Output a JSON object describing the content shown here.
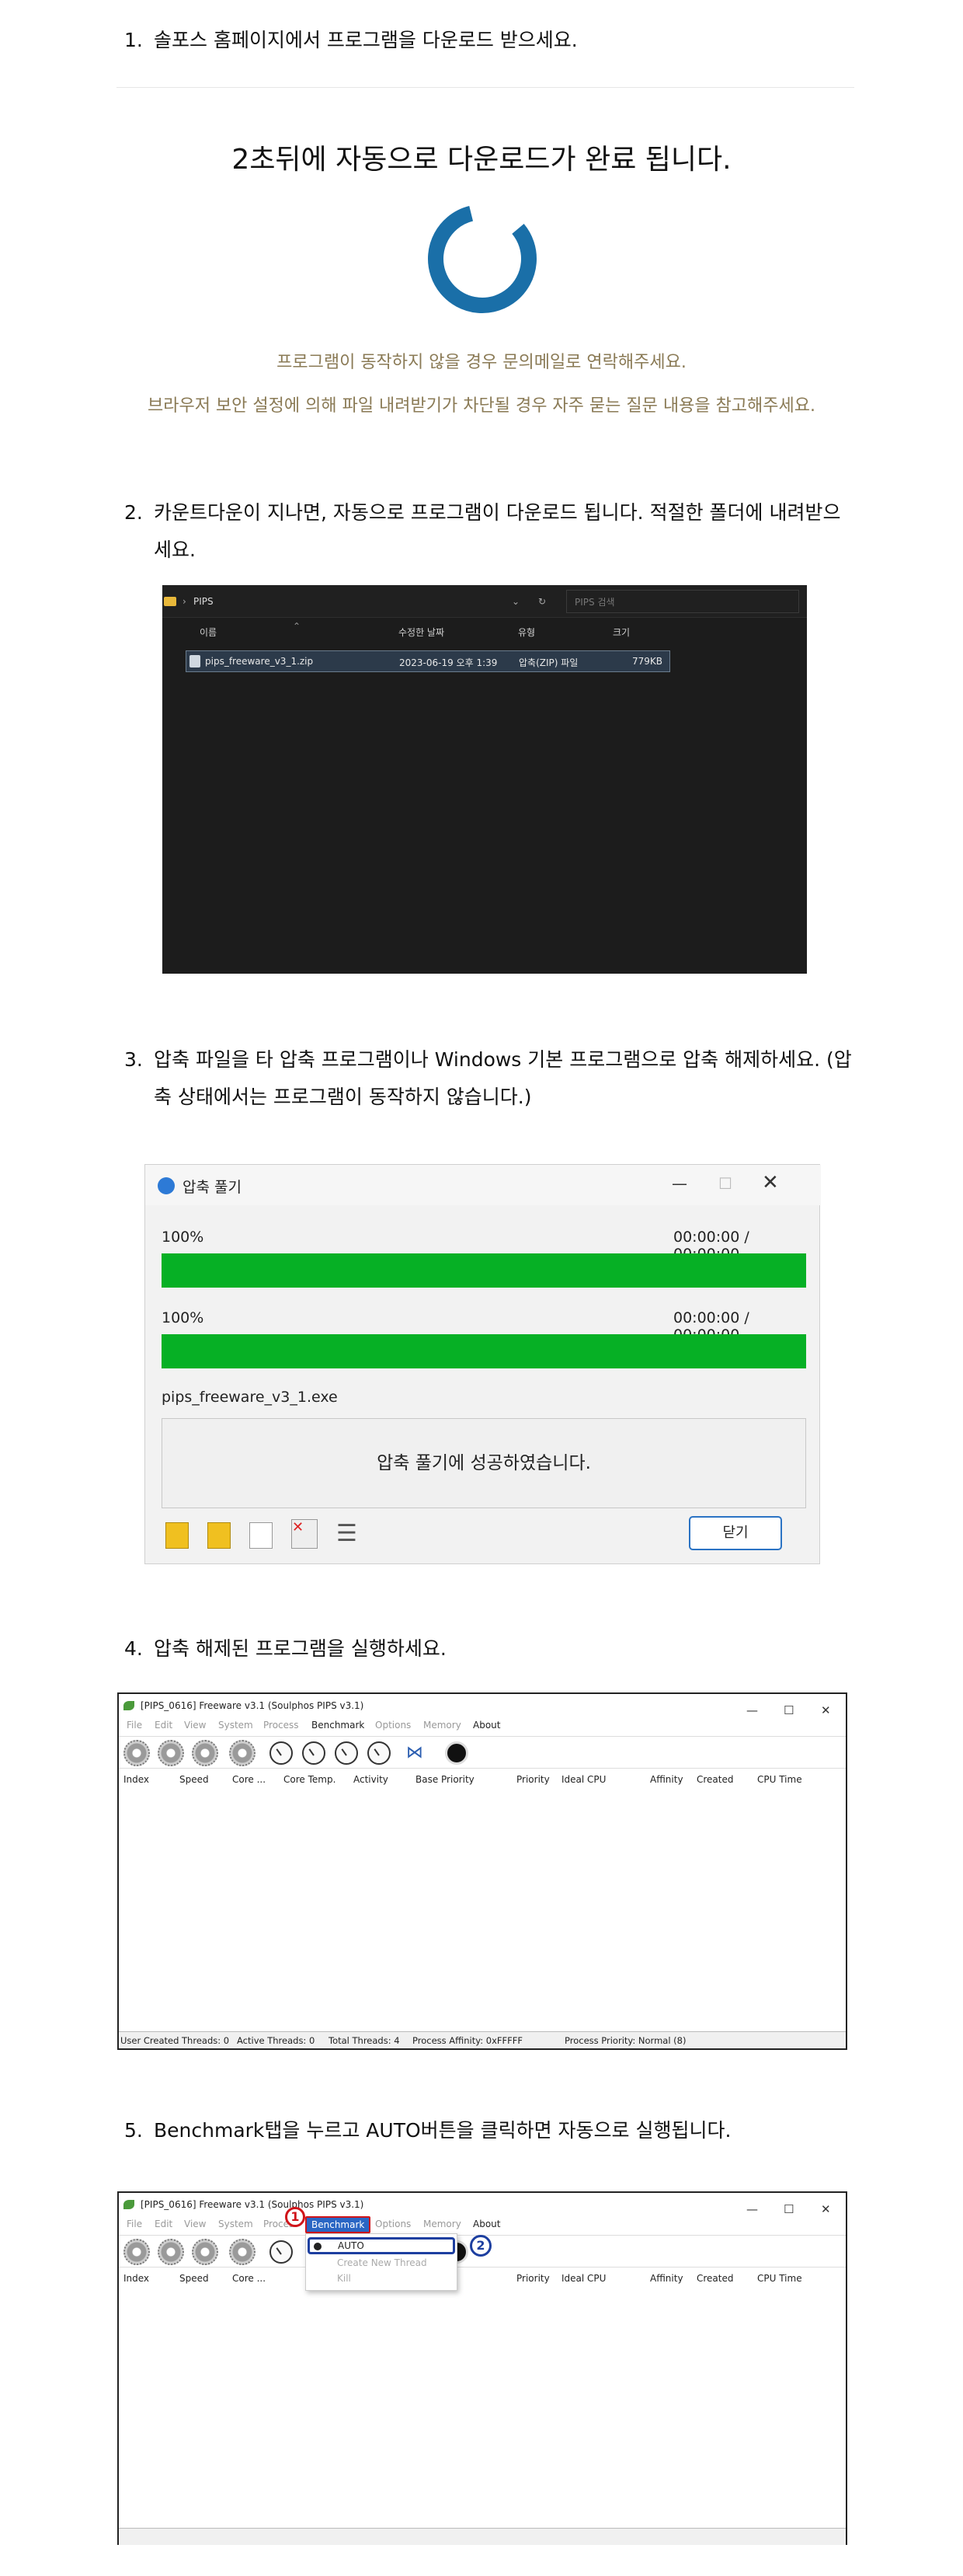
{
  "steps": {
    "s1": {
      "num": "1.",
      "text": "솔포스 홈페이지에서 프로그램을 다운로드 받으세요."
    },
    "s2": {
      "num": "2.",
      "text": "카운트다운이 지나면, 자동으로 프로그램이 다운로드 됩니다. 적절한 폴더에 내려받으세요."
    },
    "s3": {
      "num": "3.",
      "text": "압축 파일을 타 압축 프로그램이나 Windows 기본 프로그램으로 압축 해제하세요. (압축 상태에서는 프로그램이 동작하지 않습니다.)"
    },
    "s4": {
      "num": "4.",
      "text": "압축 해제된 프로그램을 실행하세요."
    },
    "s5": {
      "num": "5.",
      "text": "Benchmark탭을 누르고 AUTO버튼을 클릭하면 자동으로 실행됩니다."
    }
  },
  "download": {
    "countdown_prefix": "2",
    "countdown_text": "초뒤에 자동으로 다운로드가 완료 됩니다.",
    "help1": "프로그램이 동작하지 않을 경우 문의메일로 연락해주세요.",
    "help2": "브라우저 보안 설정에 의해 파일 내려받기가 차단될 경우 자주 묻는 질문 내용을 참고해주세요.",
    "spinner_color": "#1a6fa8"
  },
  "explorer": {
    "path": "PIPS",
    "search_placeholder": "PIPS 검색",
    "columns": [
      "이름",
      "수정한 날짜",
      "유형",
      "크기"
    ],
    "file": {
      "name": "pips_freeware_v3_1.zip",
      "date": "2023-06-19 오후 1:39",
      "type": "압축(ZIP) 파일",
      "size": "779KB"
    }
  },
  "unzip": {
    "title": "압축 풀기",
    "p1_percent": "100%",
    "p1_time": "00:00:00 / 00:00:00",
    "p2_percent": "100%",
    "p2_time": "00:00:00 / 00:00:00",
    "progress_1": 1.0,
    "progress_2": 1.0,
    "filename": "pips_freeware_v3_1.exe",
    "message": "압축 풀기에 성공하였습니다.",
    "close_label": "닫기",
    "bar_color": "#06b025"
  },
  "pips": {
    "title": "[PIPS_0616] Freeware v3.1 (Soulphos PIPS v3.1)",
    "menu": [
      "File",
      "Edit",
      "View",
      "System",
      "Process",
      "Benchmark",
      "Options",
      "Memory",
      "About"
    ],
    "columns": [
      "Index",
      "Speed",
      "Core ...",
      "Core Temp.",
      "Activity",
      "Base Priority",
      "Priority",
      "Ideal CPU",
      "Affinity",
      "Created",
      "CPU Time"
    ],
    "status": [
      "User Created Threads: 0",
      "Active Threads: 0",
      "Total Threads: 4",
      "Process Affinity: 0xFFFFF",
      "Process Priority: Normal (8)"
    ]
  },
  "pips2": {
    "title_short": "[PIPS_0616] Freeware v3.1 (Soulphos PIPS v3.1)",
    "dropdown": [
      "AUTO",
      "Create New Thread",
      "Kill"
    ],
    "marker1": "1",
    "marker2": "2",
    "highlight_color": "#d0141a",
    "auto_outline_color": "#1d3fa0"
  }
}
